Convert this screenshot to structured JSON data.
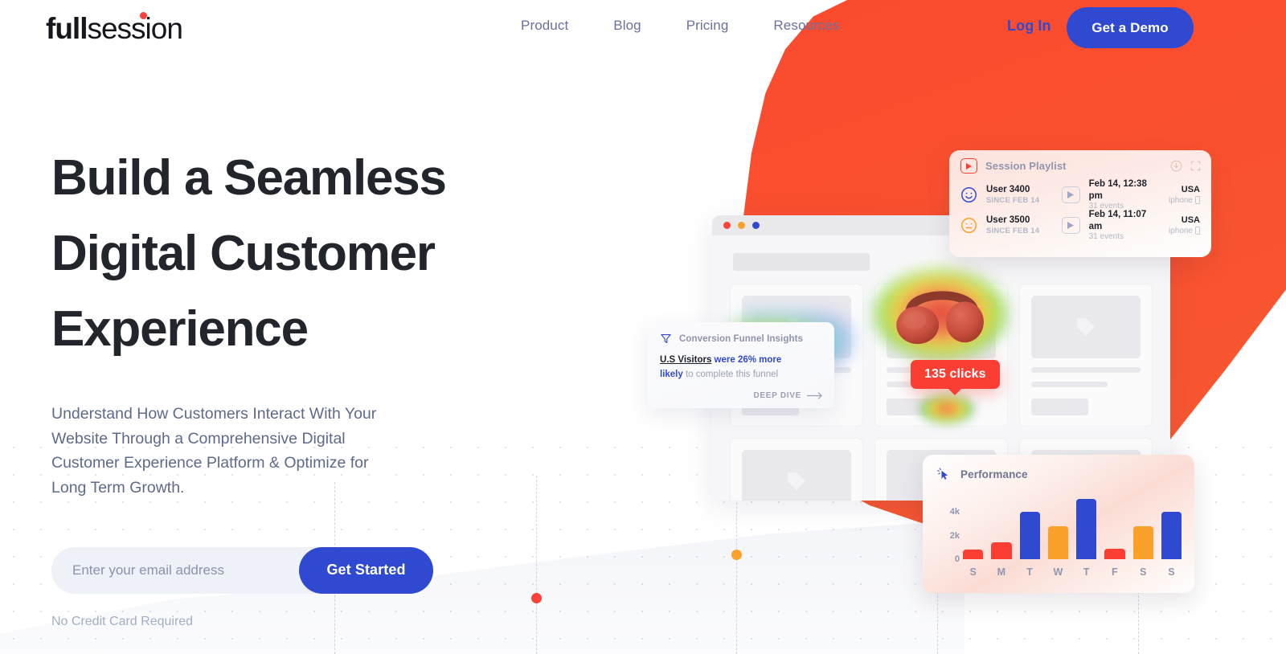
{
  "brand": {
    "logo_full": "full",
    "logo_session": "session",
    "accent_red": "#f9423a",
    "accent_blue": "#2f4ad0",
    "accent_orange": "#f9a12b"
  },
  "header": {
    "nav": [
      {
        "label": "Product"
      },
      {
        "label": "Blog"
      },
      {
        "label": "Pricing"
      },
      {
        "label": "Resources"
      }
    ],
    "login_label": "Log In",
    "demo_label": "Get a Demo"
  },
  "hero": {
    "headline_line1": "Build a Seamless",
    "headline_line2": "Digital Customer",
    "headline_line3": "Experience",
    "subhead": "Understand How Customers Interact With Your Website Through a Comprehensive Digital Customer Experience Platform & Optimize for Long Term Growth.",
    "email_placeholder": "Enter your email address",
    "email_value": "",
    "cta_label": "Get Started",
    "disclaimer": "No Credit Card Required"
  },
  "playlist": {
    "title": "Session Playlist",
    "rows": [
      {
        "user": "User 3400",
        "since": "SINCE FEB 14",
        "time": "Feb 14, 12:38 pm",
        "events": "31 events",
        "country": "USA",
        "device": "iphone",
        "mood": "happy"
      },
      {
        "user": "User 3500",
        "since": "SINCE FEB 14",
        "time": "Feb 14, 11:07 am",
        "events": "31 events",
        "country": "USA",
        "device": "iphone",
        "mood": "neutral"
      }
    ]
  },
  "funnel": {
    "title": "Conversion Funnel Insights",
    "highlight": "U.S Visitors",
    "blue_text": " were 26% more",
    "blue_text2": "likely",
    "gray_text": " to complete this funnel",
    "link_label": "DEEP DIVE"
  },
  "heatmap": {
    "clicks_badge": "135 clicks"
  },
  "chart_data": {
    "type": "bar",
    "title": "Performance",
    "categories": [
      "S",
      "M",
      "T",
      "W",
      "T",
      "F",
      "S",
      "S"
    ],
    "values": [
      800,
      1400,
      4000,
      2800,
      5100,
      900,
      2800,
      4000
    ],
    "colors": [
      "#fa3e33",
      "#fa3e33",
      "#2f4ad0",
      "#f9a12b",
      "#2f4ad0",
      "#fa3e33",
      "#f9a12b",
      "#2f4ad0"
    ],
    "ytick_labels": [
      "4k",
      "2k",
      "0"
    ],
    "ytick_values": [
      4000,
      2000,
      0
    ],
    "ylim": [
      0,
      5600
    ],
    "xlabel": "",
    "ylabel": "",
    "grid": false,
    "legend": "none"
  }
}
